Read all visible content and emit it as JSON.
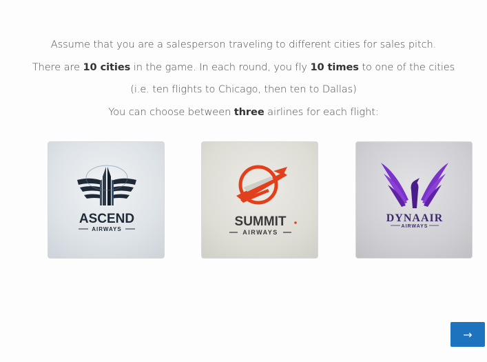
{
  "instructions": {
    "line1": "Assume that you are a salesperson traveling to different cities for sales pitch.",
    "line2_pre": "There are ",
    "line2_bold1": "10 cities",
    "line2_mid": " in the game. In each round, you fly ",
    "line2_bold2": "10 times",
    "line2_post": " to one of the cities",
    "line3": "(i.e. ten flights to Chicago, then ten to Dallas)",
    "line4_pre": "You can choose between ",
    "line4_bold": "three",
    "line4_post": " airlines for each flight:"
  },
  "airlines": [
    {
      "name": "ASCEND",
      "sub": "AIRWAYS",
      "icon": "winged-tower-icon",
      "color": "#1f2a36"
    },
    {
      "name": "SUMMIT",
      "sub": "AIRWAYS",
      "icon": "red-plane-icon",
      "color": "#e2401c"
    },
    {
      "name": "DYNAAIR",
      "sub": "AIRWAYS",
      "icon": "purple-wings-icon",
      "color": "#6c2bb7"
    }
  ],
  "next_button": {
    "label": "→",
    "icon": "arrow-right-icon",
    "color": "#1e73be"
  }
}
